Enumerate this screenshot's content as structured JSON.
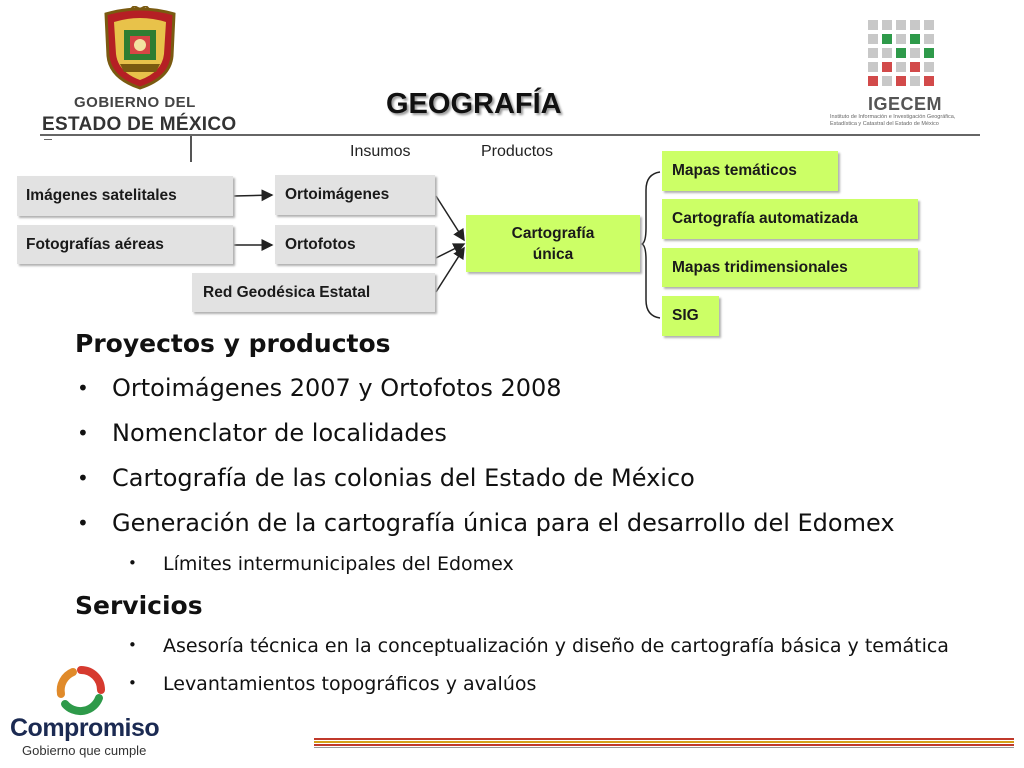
{
  "header": {
    "gov_logo": {
      "line1": "GOBIERNO DEL",
      "line2": "ESTADO DE MÉXICO"
    },
    "igecem_logo": {
      "name": "IGECEM",
      "subtitle_1": "Instituto de Información e Investigación Geográfica,",
      "subtitle_2": "Estadística y Catastral del Estado de México"
    },
    "title": "GEOGRAFÍA"
  },
  "diagram": {
    "label_insumos": "Insumos",
    "label_productos": "Productos",
    "inputs": [
      "Imágenes satelitales",
      "Fotografías aéreas"
    ],
    "intermediate": [
      "Ortoimágenes",
      "Ortofotos",
      "Red Geodésica Estatal"
    ],
    "center_line1": "Cartografía",
    "center_line2": "única",
    "outputs": [
      "Mapas temáticos",
      "Cartografía automatizada",
      "Mapas tridimensionales",
      "SIG"
    ]
  },
  "content": {
    "proyectos_heading": "Proyectos y productos",
    "proyectos_items": [
      "Ortoimágenes 2007 y Ortofotos 2008",
      "Nomenclator de localidades",
      "Cartografía de las colonias del Estado de México",
      "Generación de la cartografía única para el desarrollo del Edomex"
    ],
    "proyectos_subitem": "Límites intermunicipales del Edomex",
    "servicios_heading": "Servicios",
    "servicios_items": [
      "Asesoría técnica en la conceptualización y diseño de cartografía básica y temática",
      "Levantamientos topográficos y avalúos"
    ]
  },
  "footer": {
    "brand": "Compromiso",
    "tagline": "Gobierno que cumple"
  },
  "colors": {
    "product_box": "#ccff66",
    "input_box": "#e2e2e2",
    "footer_red": "#c0392b",
    "footer_gold": "#d4a017"
  }
}
